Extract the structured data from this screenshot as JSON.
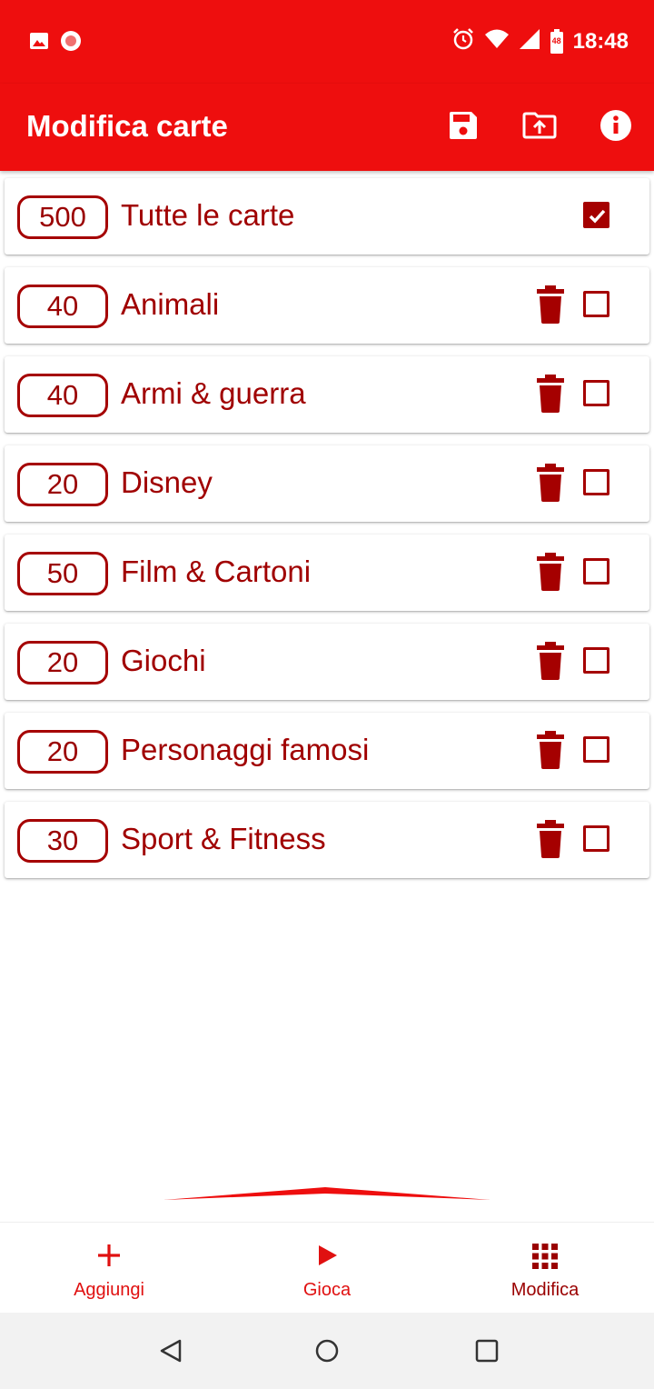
{
  "status_bar": {
    "time": "18:48",
    "battery_level": "48",
    "left_icons": [
      "image-icon",
      "record-icon"
    ],
    "right_icons": [
      "alarm-icon",
      "wifi-icon",
      "signal-icon",
      "battery-icon"
    ]
  },
  "app_bar": {
    "title": "Modifica carte",
    "actions": [
      "save-icon",
      "upload-icon",
      "info-icon"
    ]
  },
  "list": {
    "items": [
      {
        "count": "500",
        "label": "Tutte le carte",
        "checked": true,
        "deletable": false
      },
      {
        "count": "40",
        "label": "Animali",
        "checked": false,
        "deletable": true
      },
      {
        "count": "40",
        "label": "Armi & guerra",
        "checked": false,
        "deletable": true
      },
      {
        "count": "20",
        "label": "Disney",
        "checked": false,
        "deletable": true
      },
      {
        "count": "50",
        "label": "Film & Cartoni",
        "checked": false,
        "deletable": true
      },
      {
        "count": "20",
        "label": "Giochi",
        "checked": false,
        "deletable": true
      },
      {
        "count": "20",
        "label": "Personaggi famosi",
        "checked": false,
        "deletable": true
      },
      {
        "count": "30",
        "label": "Sport & Fitness",
        "checked": false,
        "deletable": true
      }
    ]
  },
  "bottom_nav": {
    "items": [
      {
        "label": "Aggiungi",
        "icon": "plus-icon",
        "active": false
      },
      {
        "label": "Gioca",
        "icon": "play-icon",
        "active": false
      },
      {
        "label": "Modifica",
        "icon": "grid-icon",
        "active": true
      }
    ]
  },
  "colors": {
    "primary": "#ee0e0e",
    "accent_dark": "#a50000",
    "nav_text": "#e01010",
    "nav_text_active": "#9a0000"
  }
}
